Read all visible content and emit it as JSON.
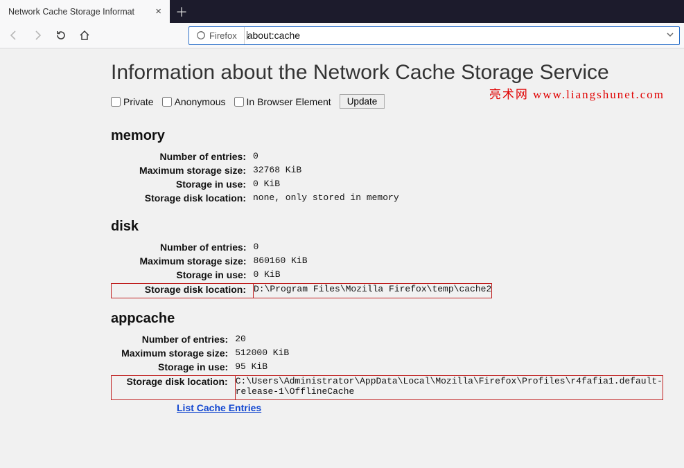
{
  "tab": {
    "title": "Network Cache Storage Informat"
  },
  "toolbar": {
    "identity_label": "Firefox",
    "url": "about:cache"
  },
  "page": {
    "title": "Information about the Network Cache Storage Service",
    "checkbox_private": "Private",
    "checkbox_anonymous": "Anonymous",
    "checkbox_inbrowser": "In Browser Element",
    "update_button": "Update"
  },
  "watermark": "亮术网 www.liangshunet.com",
  "labels": {
    "num_entries": "Number of entries:",
    "max_size": "Maximum storage size:",
    "in_use": "Storage in use:",
    "disk_loc": "Storage disk location:"
  },
  "sections": {
    "memory": {
      "heading": "memory",
      "entries": "0",
      "max_size": "32768 KiB",
      "in_use": "0 KiB",
      "disk_loc": "none, only stored in memory"
    },
    "disk": {
      "heading": "disk",
      "entries": "0",
      "max_size": "860160 KiB",
      "in_use": "0 KiB",
      "disk_loc": "D:\\Program Files\\Mozilla Firefox\\temp\\cache2"
    },
    "appcache": {
      "heading": "appcache",
      "entries": "20",
      "max_size": "512000 KiB",
      "in_use": "95 KiB",
      "disk_loc": "C:\\Users\\Administrator\\AppData\\Local\\Mozilla\\Firefox\\Profiles\\r4fafia1.default-release-1\\OfflineCache",
      "list_link": "List Cache Entries"
    }
  }
}
